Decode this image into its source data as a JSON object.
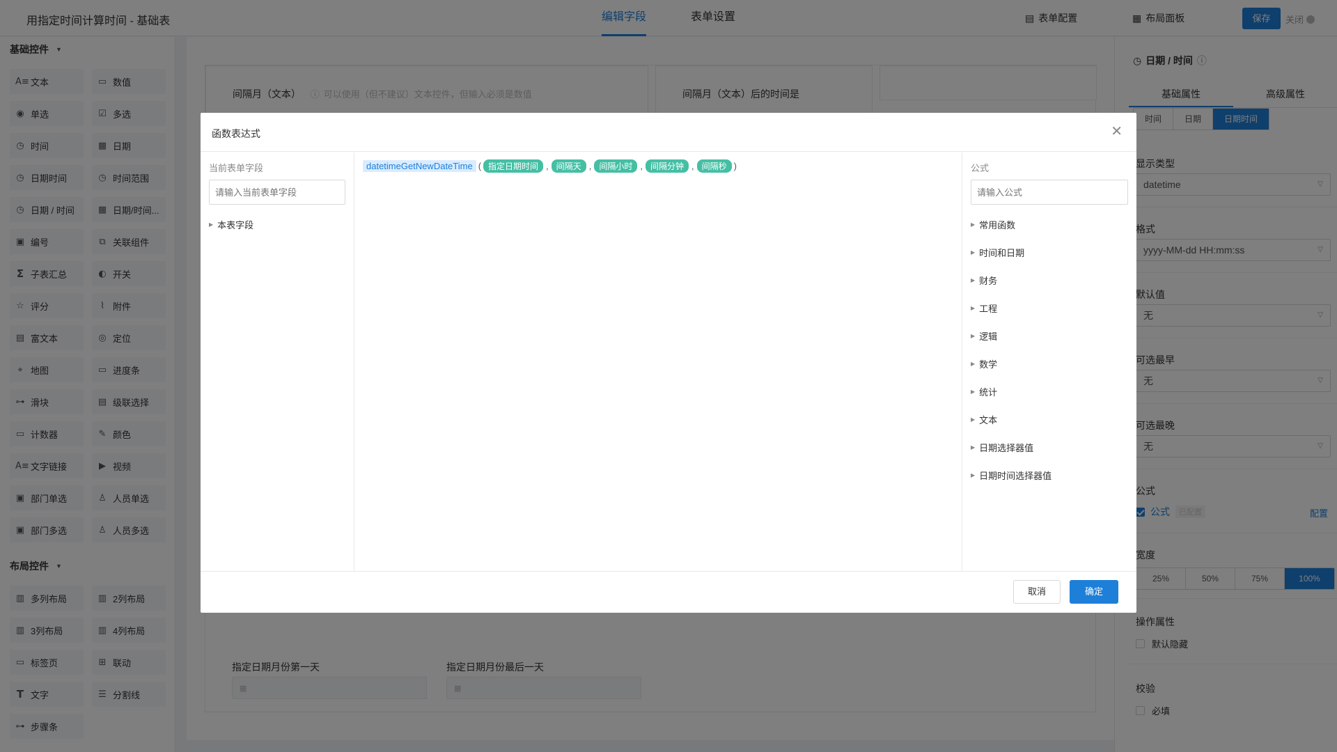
{
  "header": {
    "title": "用指定时间计算时间 - 基础表",
    "tabs": [
      "编辑字段",
      "表单设置"
    ],
    "form_config": "表单配置",
    "layout_panel": "布局面板",
    "save": "保存",
    "close": "关闭"
  },
  "sidebar": {
    "basic_title": "基础控件",
    "basic_controls": [
      {
        "label": "文本",
        "icon": "text-icon"
      },
      {
        "label": "数值",
        "icon": "number-icon"
      },
      {
        "label": "单选",
        "icon": "radio-icon"
      },
      {
        "label": "多选",
        "icon": "checkbox-icon"
      },
      {
        "label": "时间",
        "icon": "clock-icon"
      },
      {
        "label": "日期",
        "icon": "calendar-icon"
      },
      {
        "label": "日期时间",
        "icon": "clock-icon"
      },
      {
        "label": "时间范围",
        "icon": "clock-icon"
      },
      {
        "label": "日期 / 时间",
        "icon": "clock-icon"
      },
      {
        "label": "日期/时间...",
        "icon": "calendar-icon"
      },
      {
        "label": "编号",
        "icon": "number-tag-icon"
      },
      {
        "label": "关联组件",
        "icon": "link-icon"
      },
      {
        "label": "子表汇总",
        "icon": "sigma-icon"
      },
      {
        "label": "开关",
        "icon": "toggle-icon"
      },
      {
        "label": "评分",
        "icon": "star-icon"
      },
      {
        "label": "附件",
        "icon": "paperclip-icon"
      },
      {
        "label": "富文本",
        "icon": "richtext-icon"
      },
      {
        "label": "定位",
        "icon": "location-icon"
      },
      {
        "label": "地图",
        "icon": "map-icon"
      },
      {
        "label": "进度条",
        "icon": "progress-icon"
      },
      {
        "label": "滑块",
        "icon": "slider-icon"
      },
      {
        "label": "级联选择",
        "icon": "cascade-icon"
      },
      {
        "label": "计数器",
        "icon": "counter-icon"
      },
      {
        "label": "颜色",
        "icon": "color-picker-icon"
      },
      {
        "label": "文字链接",
        "icon": "text-link-icon"
      },
      {
        "label": "视频",
        "icon": "video-icon"
      },
      {
        "label": "部门单选",
        "icon": "department-icon"
      },
      {
        "label": "人员单选",
        "icon": "user-icon"
      },
      {
        "label": "部门多选",
        "icon": "department-icon"
      },
      {
        "label": "人员多选",
        "icon": "users-icon"
      }
    ],
    "layout_title": "布局控件",
    "layout_controls": [
      {
        "label": "多列布局",
        "icon": "columns-icon"
      },
      {
        "label": "2列布局",
        "icon": "columns-icon"
      },
      {
        "label": "3列布局",
        "icon": "columns-icon"
      },
      {
        "label": "4列布局",
        "icon": "columns-icon"
      },
      {
        "label": "标签页",
        "icon": "tabs-icon"
      },
      {
        "label": "联动",
        "icon": "linkage-icon"
      },
      {
        "label": "文字",
        "icon": "text-T-icon"
      },
      {
        "label": "分割线",
        "icon": "divider-icon"
      },
      {
        "label": "步骤条",
        "icon": "steps-icon"
      }
    ]
  },
  "canvas": {
    "field1_label": "间隔月（文本）",
    "field1_hint": "可以使用（但不建议）文本控件，但输入必须是数值",
    "field2_label": "间隔月（文本）后的时间是",
    "field3_label": "指定日期月份第一天",
    "field4_label": "指定日期月份最后一天"
  },
  "right_panel": {
    "title": "日期 / 时间",
    "tabs": [
      "基础属性",
      "高级属性"
    ],
    "mode_options": [
      "时间",
      "日期",
      "日期时间"
    ],
    "mode_selected": "日期时间",
    "display_type_label": "显示类型",
    "display_type_value": "datetime",
    "format_label": "格式",
    "format_value": "yyyy-MM-dd HH:mm:ss",
    "default_label": "默认值",
    "default_value": "无",
    "earliest_label": "可选最早",
    "earliest_value": "无",
    "latest_label": "可选最晚",
    "latest_value": "无",
    "formula_section_label": "公式",
    "formula_checkbox_label": "公式",
    "formula_status": "已配置",
    "formula_config_link": "配置",
    "width_label": "宽度",
    "width_options": [
      "25%",
      "50%",
      "75%",
      "100%"
    ],
    "width_selected": "100%",
    "ops_label": "操作属性",
    "hidden_label": "默认隐藏",
    "validate_label": "校验",
    "required_label": "必填"
  },
  "modal": {
    "title": "函数表达式",
    "left_label": "当前表单字段",
    "left_placeholder": "请输入当前表单字段",
    "left_tree": [
      "本表字段"
    ],
    "expression": {
      "function": "datetimeGetNewDateTime",
      "args": [
        "指定日期时间",
        "间隔天",
        "间隔小时",
        "间隔分钟",
        "间隔秒"
      ]
    },
    "right_label": "公式",
    "right_placeholder": "请输入公式",
    "categories": [
      "常用函数",
      "时间和日期",
      "财务",
      "工程",
      "逻辑",
      "数学",
      "统计",
      "文本",
      "日期选择器值",
      "日期时间选择器值"
    ],
    "cancel": "取消",
    "ok": "确定"
  },
  "colors": {
    "primary": "#1e7fd9",
    "tag": "#45bfa4",
    "overlay": "rgba(0,0,0,0.5)"
  }
}
